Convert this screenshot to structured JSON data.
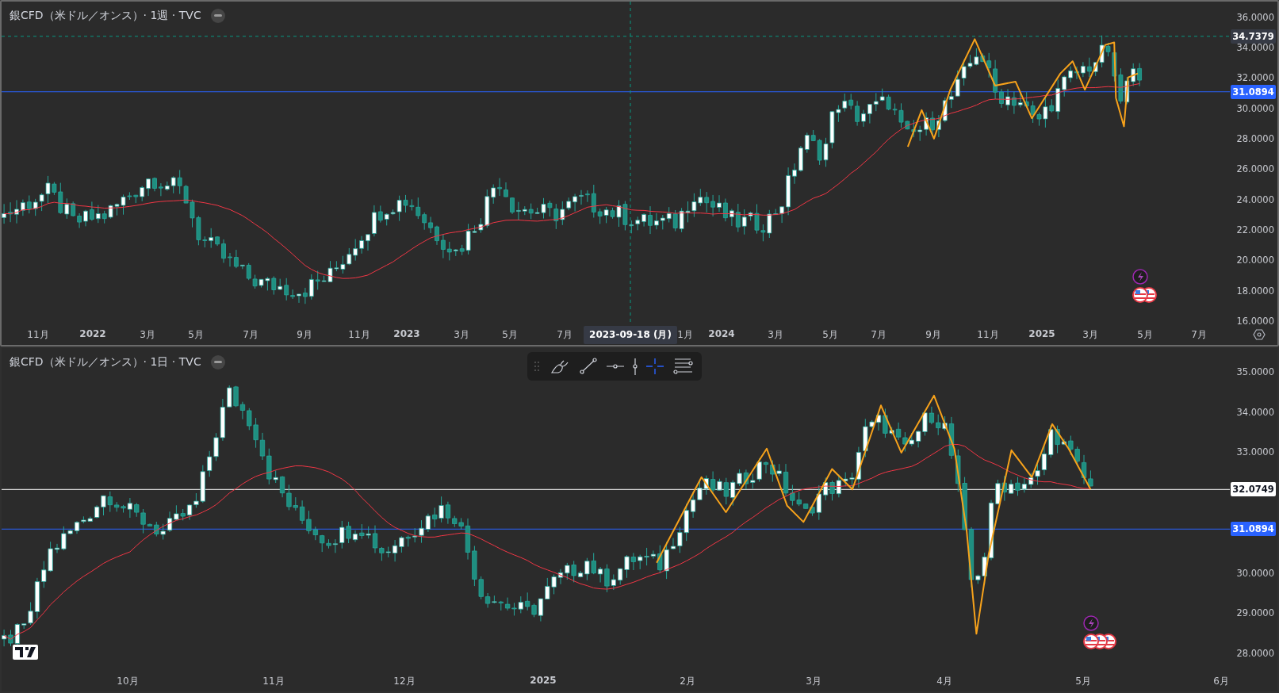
{
  "panes": [
    {
      "kind": "weekly",
      "selected": true,
      "title": "銀CFD（米ドル／オンス）· 1週 · TVC",
      "price_labels": [
        "36.0000",
        "34.0000",
        "32.0000",
        "30.0000",
        "28.0000",
        "26.0000",
        "24.0000",
        "22.0000",
        "20.0000",
        "18.0000",
        "16.0000"
      ],
      "price_markers": [
        {
          "kind": "high",
          "value": "34.7379"
        },
        {
          "kind": "line",
          "value": "31.0894",
          "color": "#2962ff"
        }
      ],
      "time_labels": [
        {
          "text": "11月",
          "kind": "month"
        },
        {
          "text": "2022",
          "kind": "year"
        },
        {
          "text": "3月",
          "kind": "month"
        },
        {
          "text": "5月",
          "kind": "month"
        },
        {
          "text": "7月",
          "kind": "month"
        },
        {
          "text": "9月",
          "kind": "month"
        },
        {
          "text": "11月",
          "kind": "month"
        },
        {
          "text": "2023",
          "kind": "year"
        },
        {
          "text": "3月",
          "kind": "month"
        },
        {
          "text": "5月",
          "kind": "month"
        },
        {
          "text": "7月",
          "kind": "month"
        },
        {
          "text": "1月",
          "kind": "month"
        },
        {
          "text": "2024",
          "kind": "year"
        },
        {
          "text": "3月",
          "kind": "month"
        },
        {
          "text": "5月",
          "kind": "month"
        },
        {
          "text": "7月",
          "kind": "month"
        },
        {
          "text": "9月",
          "kind": "month"
        },
        {
          "text": "11月",
          "kind": "month"
        },
        {
          "text": "2025",
          "kind": "year"
        },
        {
          "text": "3月",
          "kind": "month"
        },
        {
          "text": "5月",
          "kind": "month"
        },
        {
          "text": "7月",
          "kind": "month"
        }
      ],
      "crosshair": {
        "date_label": "2023-09-18 (月)"
      }
    },
    {
      "kind": "daily",
      "selected": false,
      "title": "銀CFD（米ドル／オンス）· 1日 · TVC",
      "price_labels": [
        "35.0000",
        "34.0000",
        "33.0000",
        "30.0000",
        "29.0000",
        "28.0000"
      ],
      "price_markers": [
        {
          "kind": "line",
          "value": "32.0749",
          "color": "#ffffff"
        },
        {
          "kind": "line",
          "value": "31.0894",
          "color": "#2962ff"
        }
      ],
      "time_labels": [
        {
          "text": "10月",
          "kind": "month"
        },
        {
          "text": "11月",
          "kind": "month"
        },
        {
          "text": "12月",
          "kind": "month"
        },
        {
          "text": "2025",
          "kind": "year"
        },
        {
          "text": "2月",
          "kind": "month"
        },
        {
          "text": "3月",
          "kind": "month"
        },
        {
          "text": "4月",
          "kind": "month"
        },
        {
          "text": "5月",
          "kind": "month"
        },
        {
          "text": "6月",
          "kind": "month"
        }
      ]
    }
  ],
  "drawing_toolbar": {
    "tools": [
      {
        "kind": "brush",
        "selected": false
      },
      {
        "kind": "trend-line",
        "selected": false
      },
      {
        "kind": "horizontal-ray",
        "selected": false
      },
      {
        "kind": "vertical-line",
        "selected": false
      },
      {
        "kind": "cross-line",
        "selected": true
      },
      {
        "kind": "parallel-lines",
        "selected": false
      }
    ]
  }
}
